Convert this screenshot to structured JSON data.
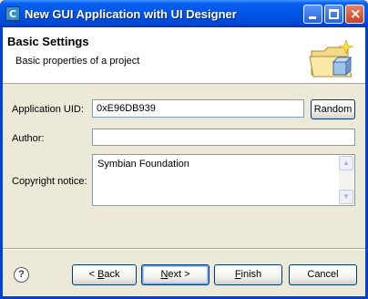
{
  "window": {
    "title": "New GUI Application with UI Designer",
    "icon_letter": "C"
  },
  "header": {
    "title": "Basic Settings",
    "subtitle": "Basic properties of a project"
  },
  "form": {
    "uid_label": "Application UID:",
    "uid_value": "0xE96DB939",
    "random_label": "Random",
    "author_label": "Author:",
    "author_value": "",
    "copyright_label": "Copyright notice:",
    "copyright_value": "Symbian Foundation"
  },
  "footer": {
    "help_glyph": "?",
    "back_prefix": "< ",
    "back_mnemonic": "B",
    "back_rest": "ack",
    "next_mnemonic": "N",
    "next_rest": "ext >",
    "finish_mnemonic": "F",
    "finish_rest": "inish",
    "cancel_label": "Cancel"
  }
}
